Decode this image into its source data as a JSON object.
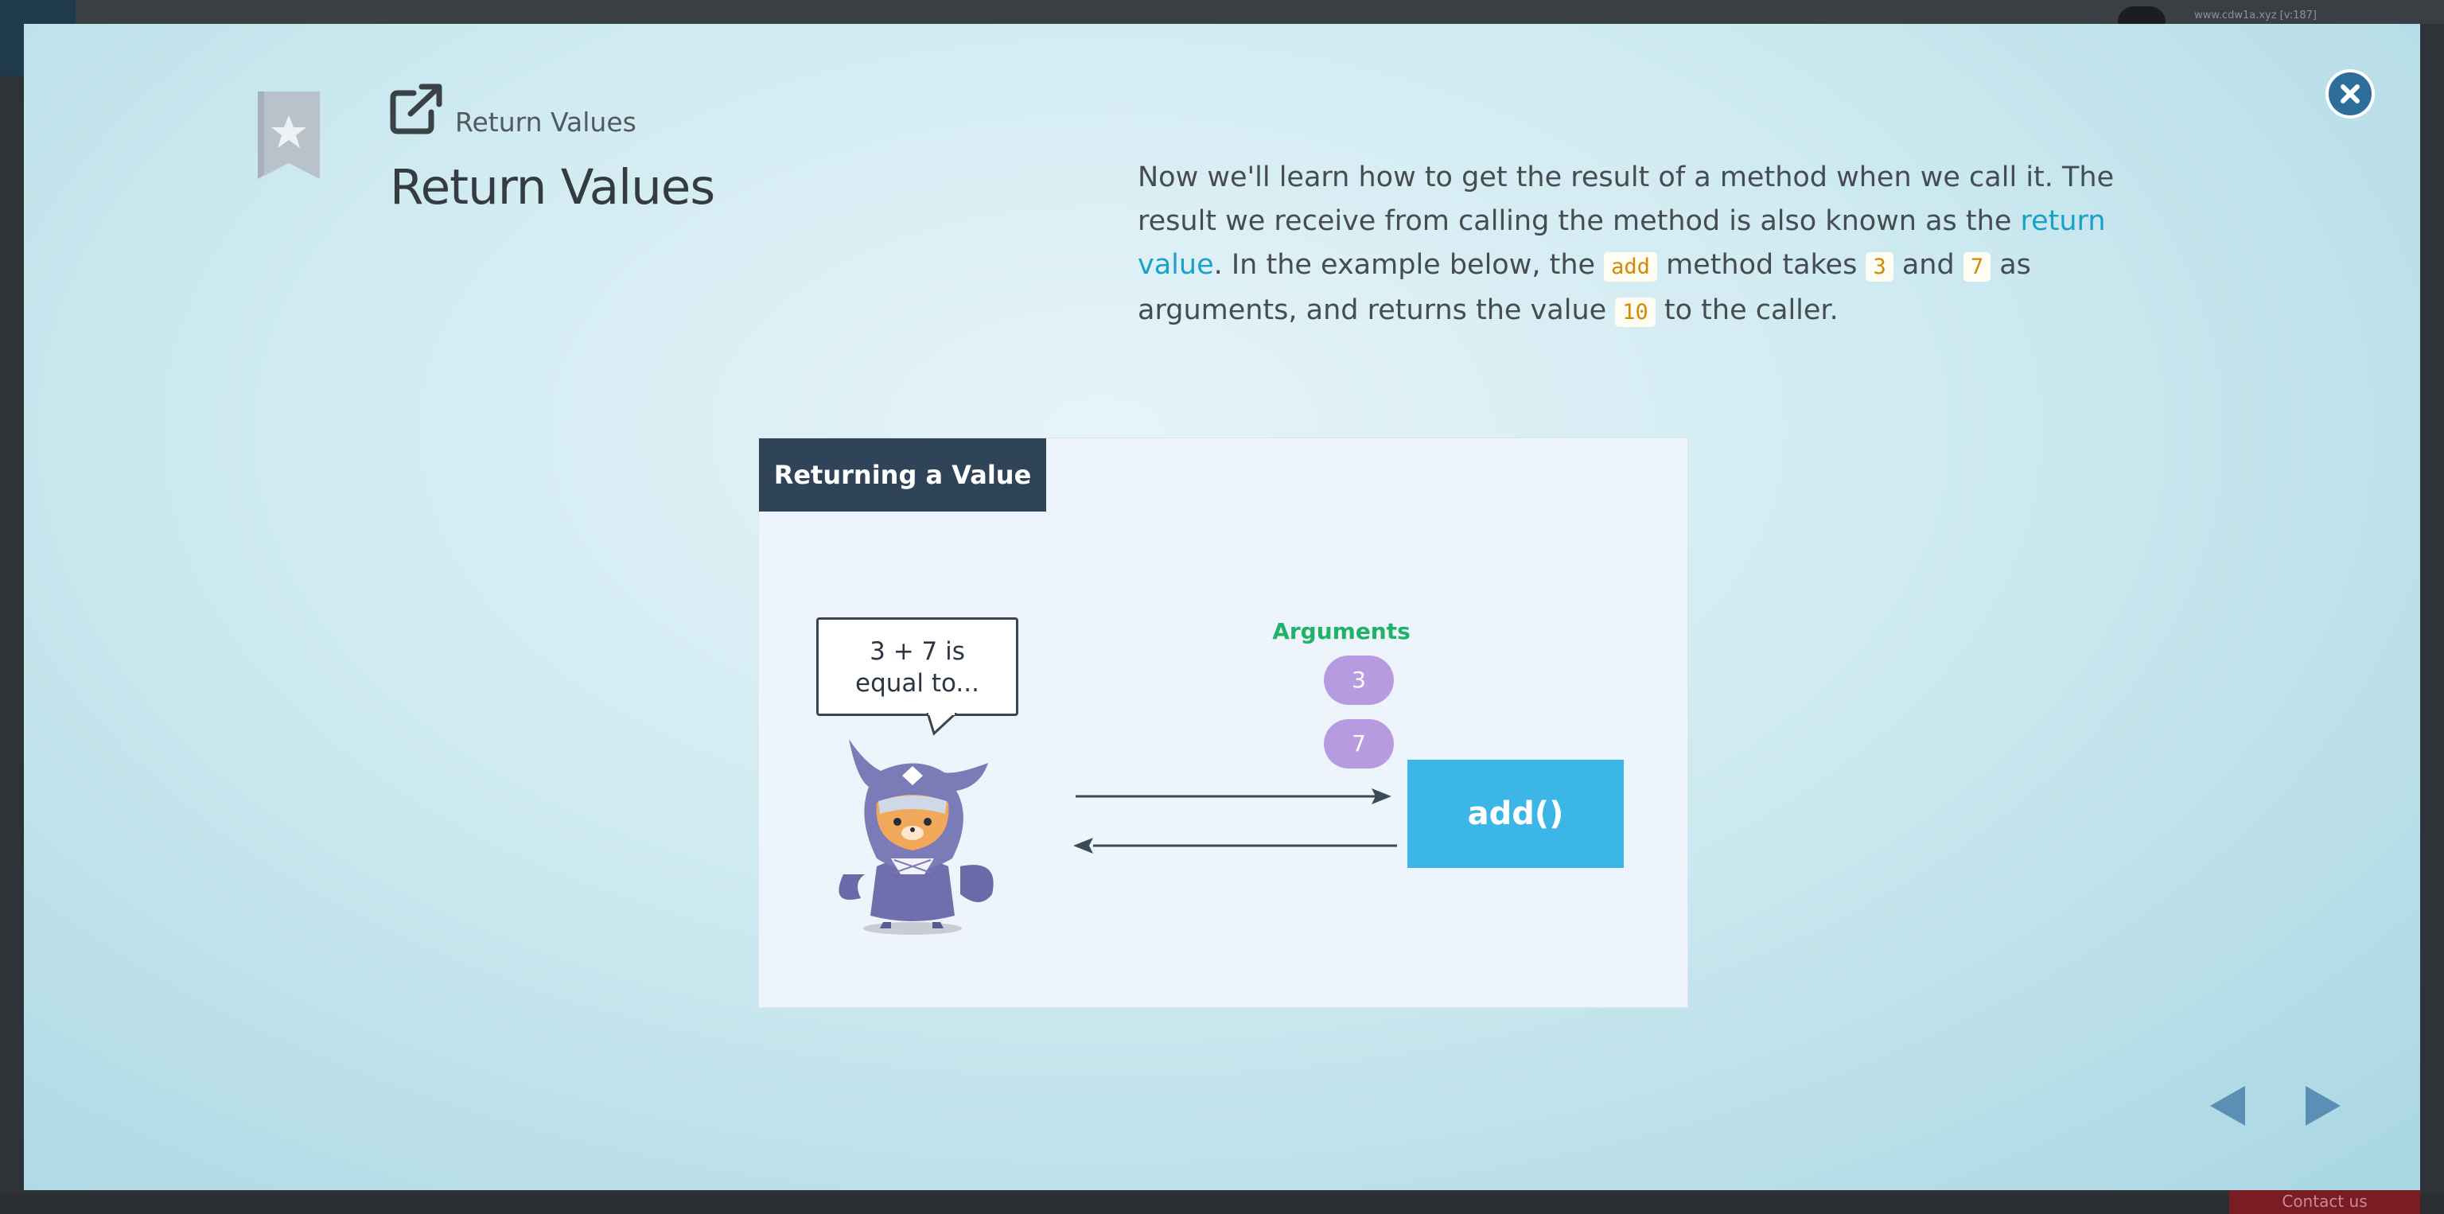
{
  "background": {
    "url_text": "www.cdw1a.xyz [v:187]",
    "contact_label": "Contact us"
  },
  "modal": {
    "breadcrumb": "Return Values",
    "title": "Return Values",
    "description": {
      "part1": "Now we'll learn how to get the result of a method when we call it. The result we receive from calling the method is also known as the ",
      "link": "return value",
      "part2": ". In the example below, the ",
      "code_add": "add",
      "part3": " method takes ",
      "code_3": "3",
      "part4": " and ",
      "code_7": "7",
      "part5": " as arguments, and returns the value ",
      "code_10": "10",
      "part6": " to the caller."
    },
    "illustration": {
      "title": "Returning a Value",
      "speech": "3 + 7 is\nequal to...",
      "arguments_label": "Arguments",
      "arg1": "3",
      "arg2": "7",
      "method_label": "add()"
    },
    "icons": {
      "close": "close-icon",
      "bookmark": "bookmark-star-icon",
      "external": "external-link-icon",
      "prev": "prev-arrow-icon",
      "next": "next-arrow-icon"
    },
    "colors": {
      "accent_link": "#1aa1c7",
      "code_text": "#d28a00",
      "title_bar": "#2f4459",
      "method_box": "#3cb6e6",
      "arg_pill": "#b79be0",
      "arguments_text": "#1fb36a",
      "nav_arrow": "#5b8fb3"
    }
  }
}
